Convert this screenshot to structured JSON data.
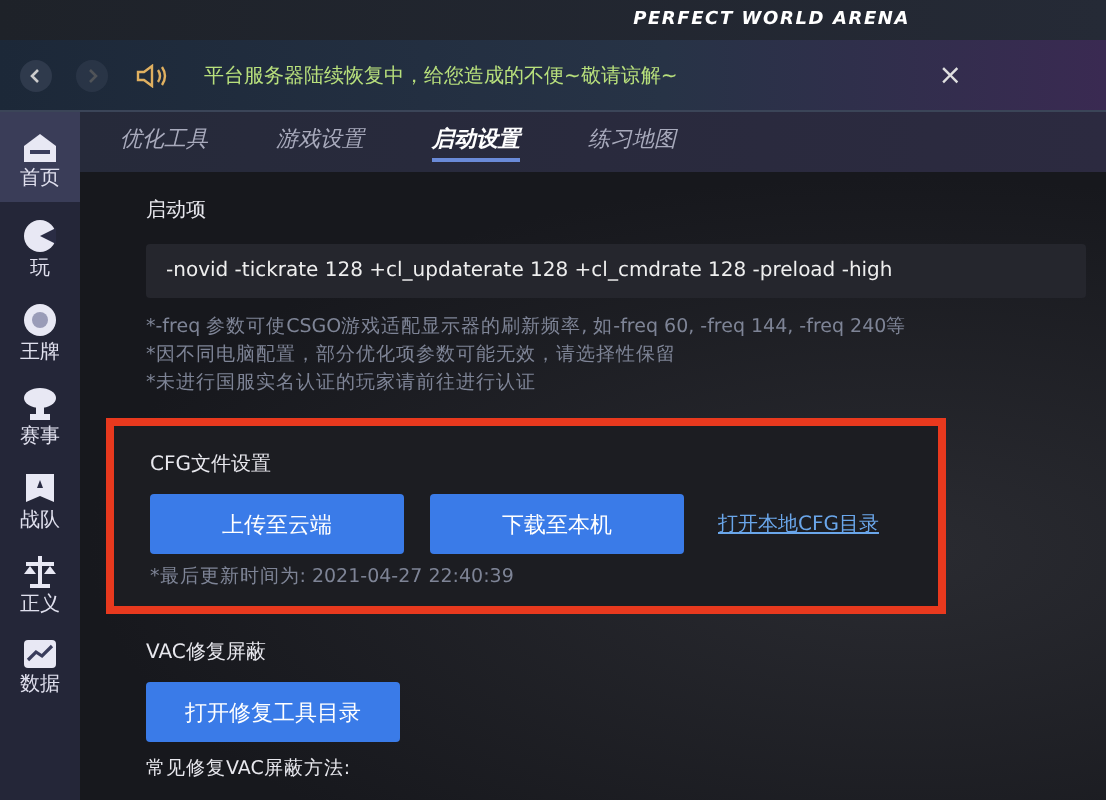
{
  "title_bar": {
    "brand": "PERFECT WORLD ARENA"
  },
  "notice_bar": {
    "message": "平台服务器陆续恢复中，给您造成的不便~敬请谅解~",
    "close": "×"
  },
  "sidebar": {
    "items": [
      {
        "label": "首页",
        "kind": "home",
        "selected": true
      },
      {
        "label": "玩",
        "kind": "play",
        "selected": false
      },
      {
        "label": "王牌",
        "kind": "ace",
        "selected": false
      },
      {
        "label": "赛事",
        "kind": "trophy",
        "selected": false
      },
      {
        "label": "战队",
        "kind": "team",
        "selected": false
      },
      {
        "label": "正义",
        "kind": "scale",
        "selected": false
      },
      {
        "label": "数据",
        "kind": "chart",
        "selected": false
      }
    ]
  },
  "tabs": [
    {
      "label": "优化工具",
      "selected": false
    },
    {
      "label": "游戏设置",
      "selected": false
    },
    {
      "label": "启动设置",
      "selected": true
    },
    {
      "label": "练习地图",
      "selected": false
    }
  ],
  "launch_options": {
    "title": "启动项",
    "value": "-novid -tickrate 128 +cl_updaterate 128 +cl_cmdrate 128 -preload -high",
    "notes": [
      "*-freq 参数可使CSGO游戏适配显示器的刷新频率, 如-freq 60, -freq 144, -freq 240等",
      "*因不同电脑配置，部分优化项参数可能无效，请选择性保留",
      "*未进行国服实名认证的玩家请前往进行认证"
    ]
  },
  "cfg_section": {
    "title": "CFG文件设置",
    "highlighted": true,
    "buttons": [
      "上传至云端",
      "下载至本机"
    ],
    "link": "打开本地CFG目录",
    "last_updated": "*最后更新时间为: 2021-04-27 22:40:39"
  },
  "vac_section": {
    "title": "VAC修复屏蔽",
    "button": "打开修复工具目录",
    "subtitle": "常见修复VAC屏蔽方法:"
  }
}
